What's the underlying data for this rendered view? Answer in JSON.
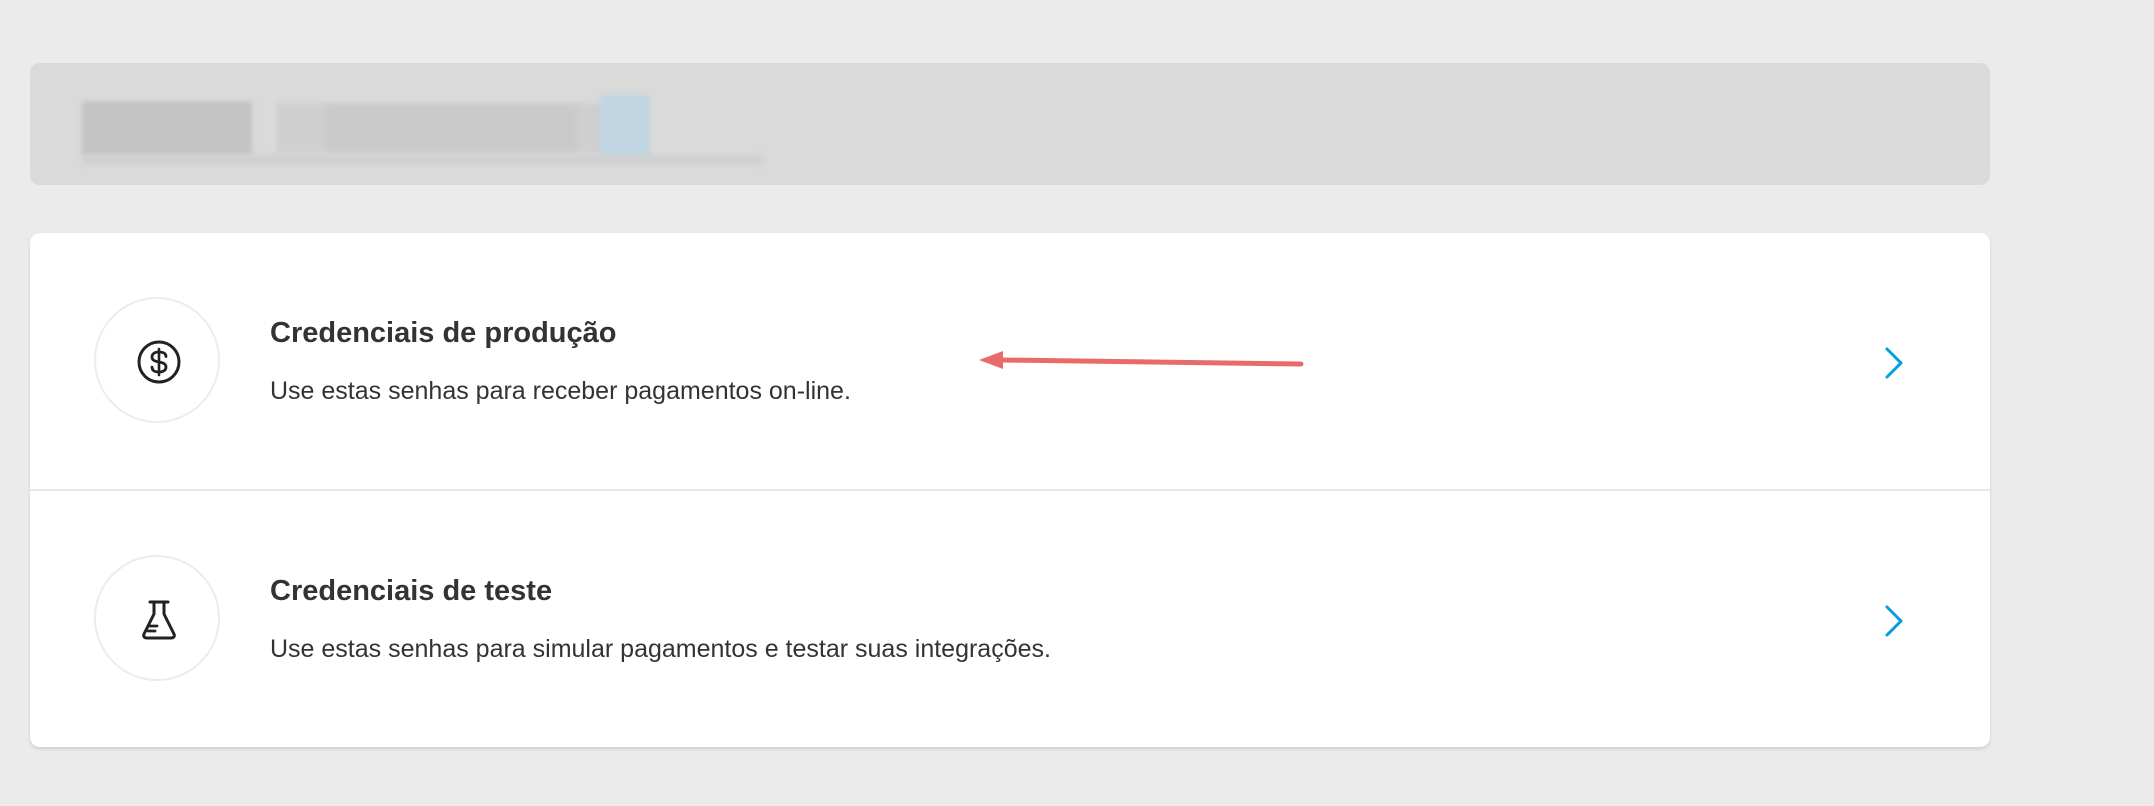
{
  "credentials": {
    "items": [
      {
        "title": "Credenciais de produção",
        "description": "Use estas senhas para receber pagamentos on-line.",
        "icon": "dollar-circle-icon"
      },
      {
        "title": "Credenciais de teste",
        "description": "Use estas senhas para simular pagamentos e testar suas integrações.",
        "icon": "flask-icon"
      }
    ]
  },
  "colors": {
    "background": "#ebebeb",
    "card": "#ffffff",
    "text": "#333333",
    "accent": "#009ee3",
    "annotation": "#e96a6a"
  }
}
